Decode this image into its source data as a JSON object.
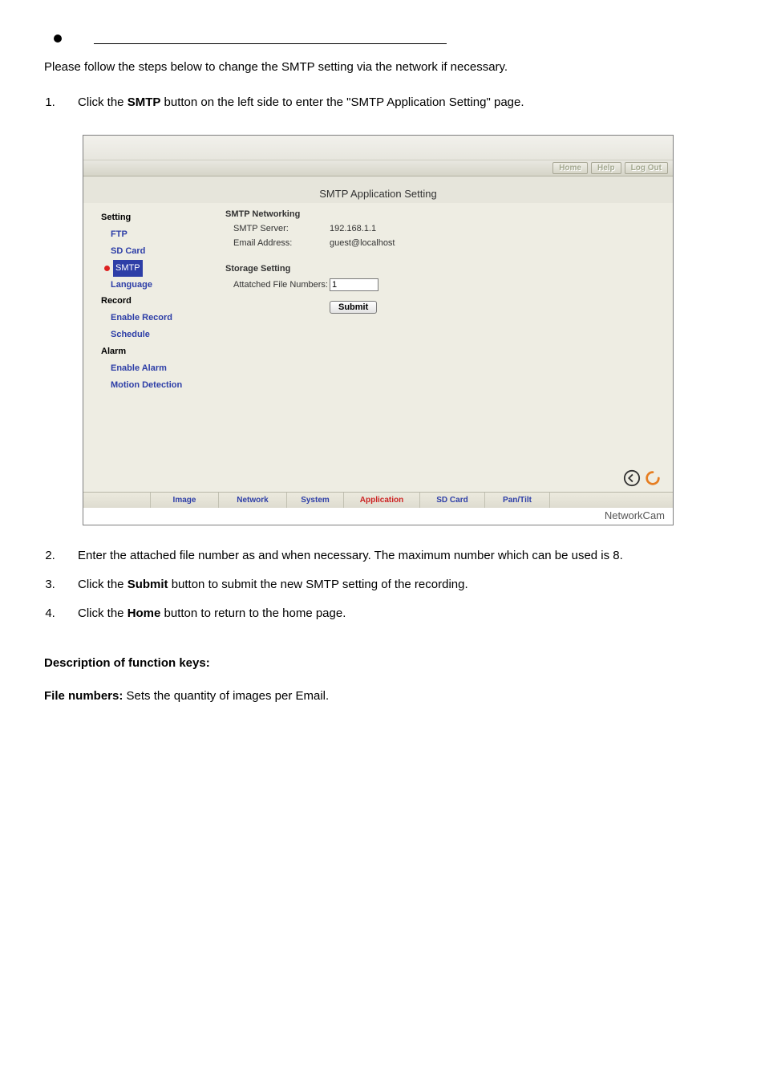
{
  "intro": "Please follow the steps below to change the SMTP setting via the network if necessary.",
  "steps1": {
    "n": "1.",
    "pre": "Click the ",
    "bold": "SMTP",
    "post": " button on the left side to enter the \"SMTP Application Setting\" page."
  },
  "screenshot": {
    "top_buttons": {
      "home": "Home",
      "help": "Help",
      "logout": "Log Out"
    },
    "title": "SMTP Application Setting",
    "sidebar": {
      "setting": "Setting",
      "ftp": "FTP",
      "sdcard": "SD Card",
      "smtp": "SMTP",
      "language": "Language",
      "record": "Record",
      "enable_record": "Enable Record",
      "schedule": "Schedule",
      "alarm": "Alarm",
      "enable_alarm": "Enable Alarm",
      "motion": "Motion Detection"
    },
    "smtp_section": {
      "head": "SMTP Networking",
      "server_label": "SMTP Server:",
      "server_value": "192.168.1.1",
      "email_label": "Email Address:",
      "email_value": "guest@localhost"
    },
    "storage_section": {
      "head": "Storage Setting",
      "file_label": "Attatched File Numbers:",
      "file_value": "1"
    },
    "submit": "Submit",
    "tabs": {
      "image": "Image",
      "network": "Network",
      "system": "System",
      "application": "Application",
      "sdcard": "SD Card",
      "pantilt": "Pan/Tilt"
    },
    "brand": "NetworkCam"
  },
  "steps2": {
    "n": "2.",
    "text": "Enter the attached file number as and when necessary. The maximum number which can be used is 8."
  },
  "steps3": {
    "n": "3.",
    "pre": "Click the ",
    "bold": "Submit",
    "post": " button to submit the new SMTP setting of the recording."
  },
  "steps4": {
    "n": "4.",
    "pre": "Click the ",
    "bold": "Home",
    "post": " button to return to the home page."
  },
  "desc_head": "Description of function keys:",
  "desc_line": {
    "bold": "File numbers:",
    "text": " Sets the quantity of images per Email."
  }
}
